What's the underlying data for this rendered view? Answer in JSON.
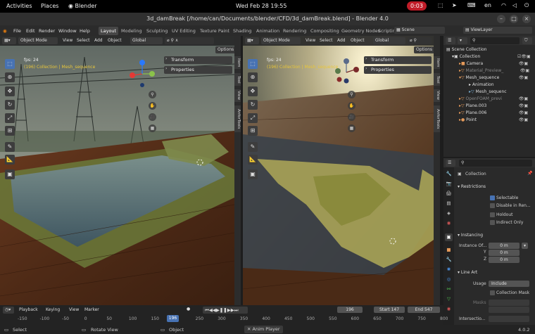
{
  "gnome": {
    "activities": "Activities",
    "places": "Places",
    "app": "Blender",
    "clock": "Wed Feb 28  19:55",
    "recording": "0:03",
    "lang": "en"
  },
  "window": {
    "title": "3d_damBreak [/home/can/Documents/blender/CFD/3d_damBreak.blend] - Blender 4.0"
  },
  "menu": {
    "items": [
      "File",
      "Edit",
      "Render",
      "Window",
      "Help"
    ],
    "workspaces": [
      "Layout",
      "Modeling",
      "Sculpting",
      "UV Editing",
      "Texture Paint",
      "Shading",
      "Animation",
      "Rendering",
      "Compositing",
      "Geometry Nodes",
      "Scripting"
    ],
    "scene": "Scene",
    "viewlayer": "ViewLayer"
  },
  "viewport_left": {
    "mode": "Object Mode",
    "view": "View",
    "select": "Select",
    "add": "Add",
    "object": "Object",
    "orientation": "Global",
    "options": "Options",
    "fps": "fps: 24",
    "collection": "(196) Collection | Mesh_sequence",
    "panel_transform": "Transform",
    "panel_properties": "Properties"
  },
  "viewport_right": {
    "mode": "Object Mode",
    "view": "View",
    "select": "Select",
    "add": "Add",
    "object": "Object",
    "orientation": "Global",
    "options": "Options",
    "fps": "fps: 24",
    "collection": "(196) Collection | Mesh_sequence",
    "panel_transform": "Transform",
    "panel_properties": "Properties"
  },
  "side_tabs": [
    "Item",
    "Tool",
    "View",
    "AnforTools"
  ],
  "outliner": {
    "rows": [
      {
        "name": "Scene Collection",
        "indent": 0
      },
      {
        "name": "Collection",
        "indent": 1
      },
      {
        "name": "Camera",
        "indent": 2
      },
      {
        "name": "Material_Preview_",
        "indent": 2
      },
      {
        "name": "Mesh_sequence",
        "indent": 2
      },
      {
        "name": "Animation",
        "indent": 3
      },
      {
        "name": "Mesh_sequenc",
        "indent": 3
      },
      {
        "name": "OpenFOAM_previ",
        "indent": 2
      },
      {
        "name": "Plane.003",
        "indent": 2
      },
      {
        "name": "Plane.006",
        "indent": 2
      },
      {
        "name": "Point",
        "indent": 2
      }
    ]
  },
  "properties": {
    "collection": "Collection",
    "restrictions": "Restrictions",
    "selectable": "Selectable",
    "disable_in_renders": "Disable in Ren...",
    "holdout": "Holdout",
    "indirect_only": "Indirect Only",
    "instancing": "Instancing",
    "instance_offset": "Instance Of...",
    "x": "X",
    "y": "Y",
    "z": "Z",
    "x_val": "0 m",
    "y_val": "0 m",
    "z_val": "0 m",
    "line_art": "Line Art",
    "usage": "Usage",
    "usage_val": "Include",
    "collection_mask": "Collection Mask",
    "masks": "Masks",
    "intersection": "Intersectio..."
  },
  "timeline": {
    "playback": "Playback",
    "keying": "Keying",
    "view": "View",
    "marker": "Marker",
    "current": "196",
    "start_label": "Start",
    "start": "147",
    "end_label": "End",
    "end": "547",
    "ticks": [
      "-150",
      "-100",
      "-50",
      "0",
      "50",
      "100",
      "150",
      "196",
      "250",
      "300",
      "350",
      "400",
      "450",
      "500",
      "550",
      "600",
      "650",
      "700",
      "750",
      "800"
    ]
  },
  "status": {
    "select": "Select",
    "rotate": "Rotate View",
    "object": "Object",
    "anim": "Anim Player",
    "version": "4.0.2"
  }
}
